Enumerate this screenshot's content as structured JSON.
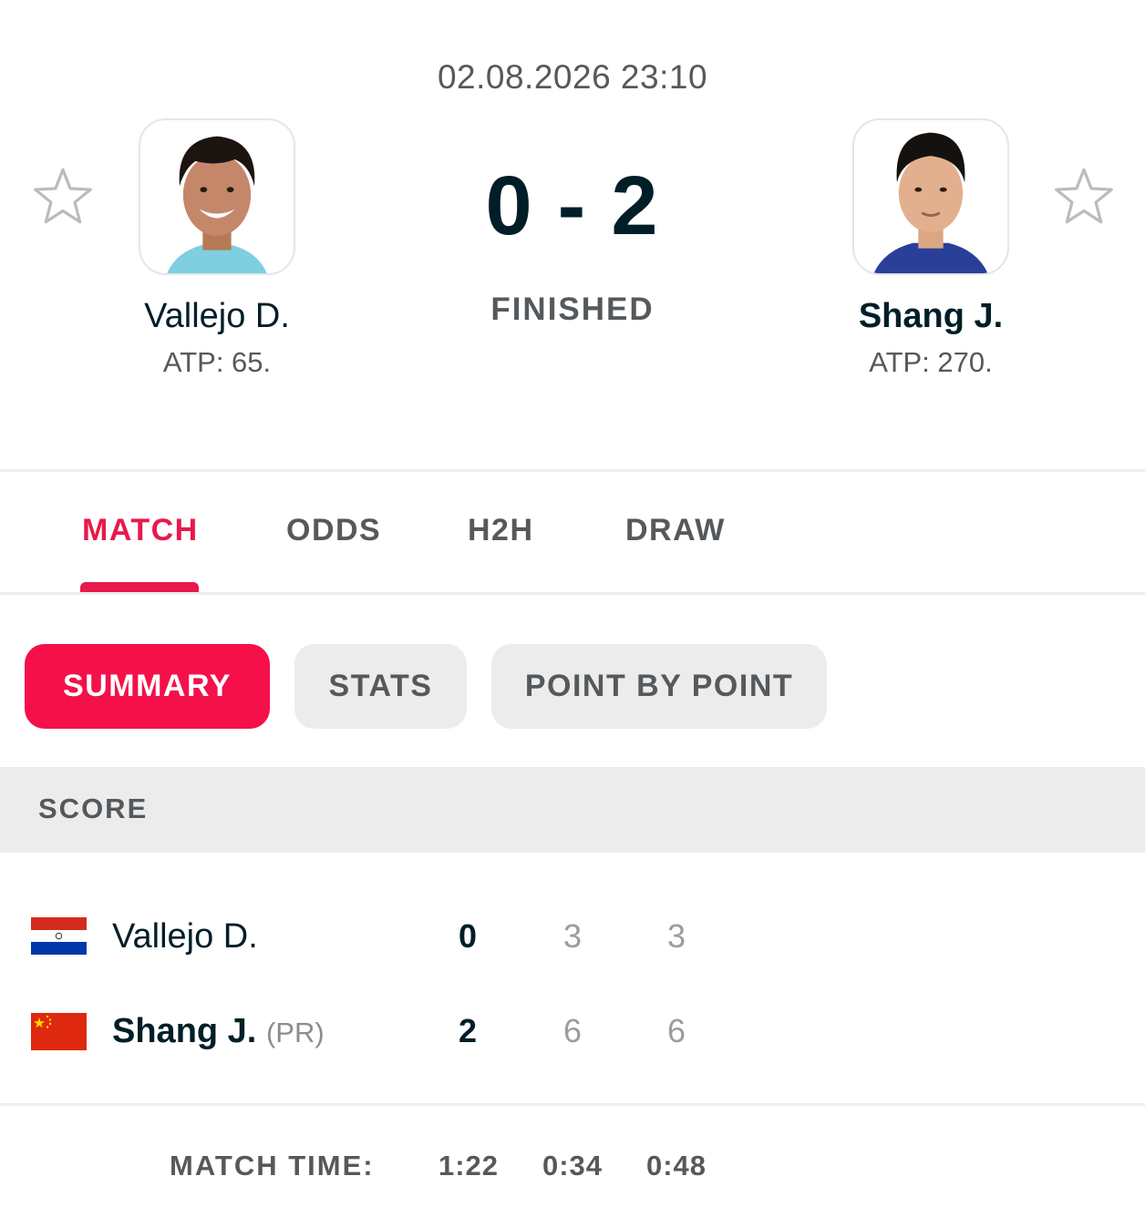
{
  "match": {
    "datetime": "02.08.2026 23:10",
    "score_home": "0",
    "score_separator": "-",
    "score_away": "2",
    "status": "FINISHED"
  },
  "home": {
    "name": "Vallejo D.",
    "rank": "ATP: 65.",
    "country_flag": "paraguay-flag"
  },
  "away": {
    "name": "Shang J.",
    "rank": "ATP: 270.",
    "country_flag": "china-flag"
  },
  "tabs": [
    {
      "label": "MATCH",
      "active": true
    },
    {
      "label": "ODDS",
      "active": false
    },
    {
      "label": "H2H",
      "active": false
    },
    {
      "label": "DRAW",
      "active": false
    }
  ],
  "subtabs": [
    {
      "label": "SUMMARY",
      "active": true
    },
    {
      "label": "STATS",
      "active": false
    },
    {
      "label": "POINT BY POINT",
      "active": false
    }
  ],
  "score_section": {
    "title": "SCORE",
    "rows": [
      {
        "name": "Vallejo D.",
        "tag": "",
        "total": "0",
        "sets": [
          "3",
          "3"
        ]
      },
      {
        "name": "Shang J.",
        "tag": "(PR)",
        "total": "2",
        "sets": [
          "6",
          "6"
        ]
      }
    ]
  },
  "match_time": {
    "label": "MATCH TIME:",
    "total": "1:22",
    "sets": [
      "0:34",
      "0:48"
    ]
  },
  "colors": {
    "accent": "#e8194b",
    "text_dark": "#001e28",
    "text_muted": "#55595c",
    "pill_bg": "#ececec"
  }
}
